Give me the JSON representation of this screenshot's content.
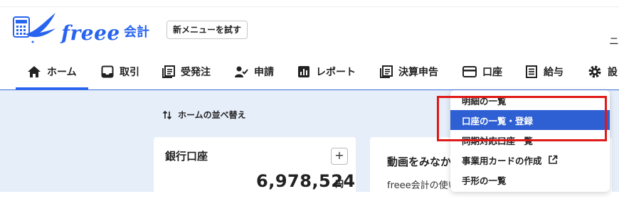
{
  "brand": {
    "name": "freee",
    "product": "会計"
  },
  "header": {
    "try_new_menu": "新メニューを試す",
    "cut_text": "ニ"
  },
  "nav": {
    "items": [
      {
        "label": "ホーム",
        "icon": "home-icon"
      },
      {
        "label": "取引",
        "icon": "inbox-icon"
      },
      {
        "label": "受発注",
        "icon": "document-icon"
      },
      {
        "label": "申請",
        "icon": "person-check-icon"
      },
      {
        "label": "レポート",
        "icon": "bar-chart-icon"
      },
      {
        "label": "決算申告",
        "icon": "document-icon"
      },
      {
        "label": "口座",
        "icon": "card-icon"
      },
      {
        "label": "給与",
        "icon": "receipt-icon"
      },
      {
        "label": "設",
        "icon": "gear-icon"
      }
    ]
  },
  "main": {
    "sort_label": "ホームの並べ替え"
  },
  "bank_card": {
    "title": "銀行口座",
    "amount": "6,978,524",
    "unit": "円"
  },
  "video_card": {
    "title": "動画をみなか",
    "text": "freee会計の使い"
  },
  "dropdown": {
    "items": [
      "明細の一覧",
      "口座の一覧・登録",
      "同期対応口座一覧",
      "事業用カードの作成",
      "手形の一覧"
    ],
    "selected_index": 1
  },
  "colors": {
    "accent": "#2864f0",
    "selected": "#2e5fd3",
    "highlight_box": "#e01818",
    "background": "#e6eef9"
  }
}
